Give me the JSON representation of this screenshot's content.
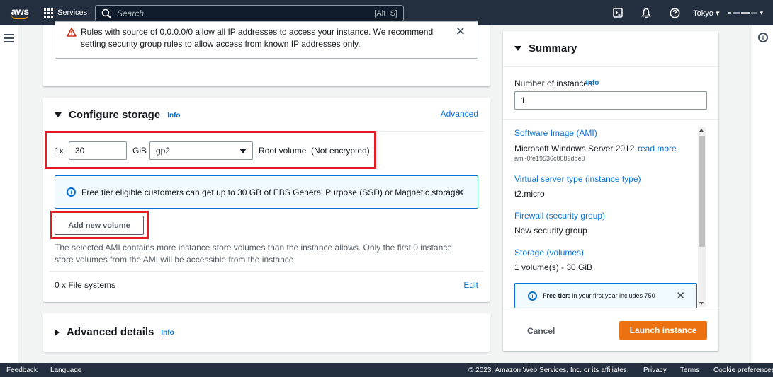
{
  "nav": {
    "logo": "aws",
    "services_label": "Services",
    "search_placeholder": "Search",
    "search_shortcut": "[Alt+S]",
    "region": "Tokyo",
    "icons": [
      "cloudshell-icon",
      "bell-icon",
      "help-icon"
    ]
  },
  "security_warning": {
    "text": "Rules with source of 0.0.0.0/0 allow all IP addresses to access your instance. We recommend setting security group rules to allow access from known IP addresses only."
  },
  "storage": {
    "title": "Configure storage",
    "info": "Info",
    "advanced": "Advanced",
    "count_label": "1x",
    "size_value": "30",
    "unit": "GiB",
    "volume_type": "gp2",
    "root_label": "Root volume  (Not encrypted)",
    "free_tier_msg": "Free tier eligible customers can get up to 30 GB of EBS General Purpose (SSD) or Magnetic storage",
    "add_volume": "Add new volume",
    "instance_store_note": "The selected AMI contains more instance store volumes than the instance allows. Only the first 0 instance store volumes from the AMI will be accessible from the instance",
    "file_systems": "0 x File systems",
    "edit": "Edit"
  },
  "advanced_details": {
    "title": "Advanced details",
    "info": "Info"
  },
  "summary": {
    "title": "Summary",
    "num_instances_label": "Number of instances",
    "info": "Info",
    "num_instances_value": "1",
    "ami_label": "Software Image (AMI)",
    "ami_value": "Microsoft Windows Server 2012 ...",
    "read_more": "read more",
    "ami_id": "ami-0fe19536c0089dde0",
    "instance_type_label": "Virtual server type (instance type)",
    "instance_type_value": "t2.micro",
    "firewall_label": "Firewall (security group)",
    "firewall_value": "New security group",
    "storage_label": "Storage (volumes)",
    "storage_value": "1 volume(s) - 30 GiB",
    "free_tier_bold": "Free tier:",
    "free_tier_text": " In your first year includes 750",
    "cancel": "Cancel",
    "launch": "Launch instance"
  },
  "footer": {
    "feedback": "Feedback",
    "language": "Language",
    "copyright": "© 2023, Amazon Web Services, Inc. or its affiliates.",
    "privacy": "Privacy",
    "terms": "Terms",
    "cookies": "Cookie preferences"
  },
  "colors": {
    "nav_bg": "#232f3e",
    "accent": "#ec7211",
    "link": "#0972d3",
    "highlight": "#e41c23"
  }
}
